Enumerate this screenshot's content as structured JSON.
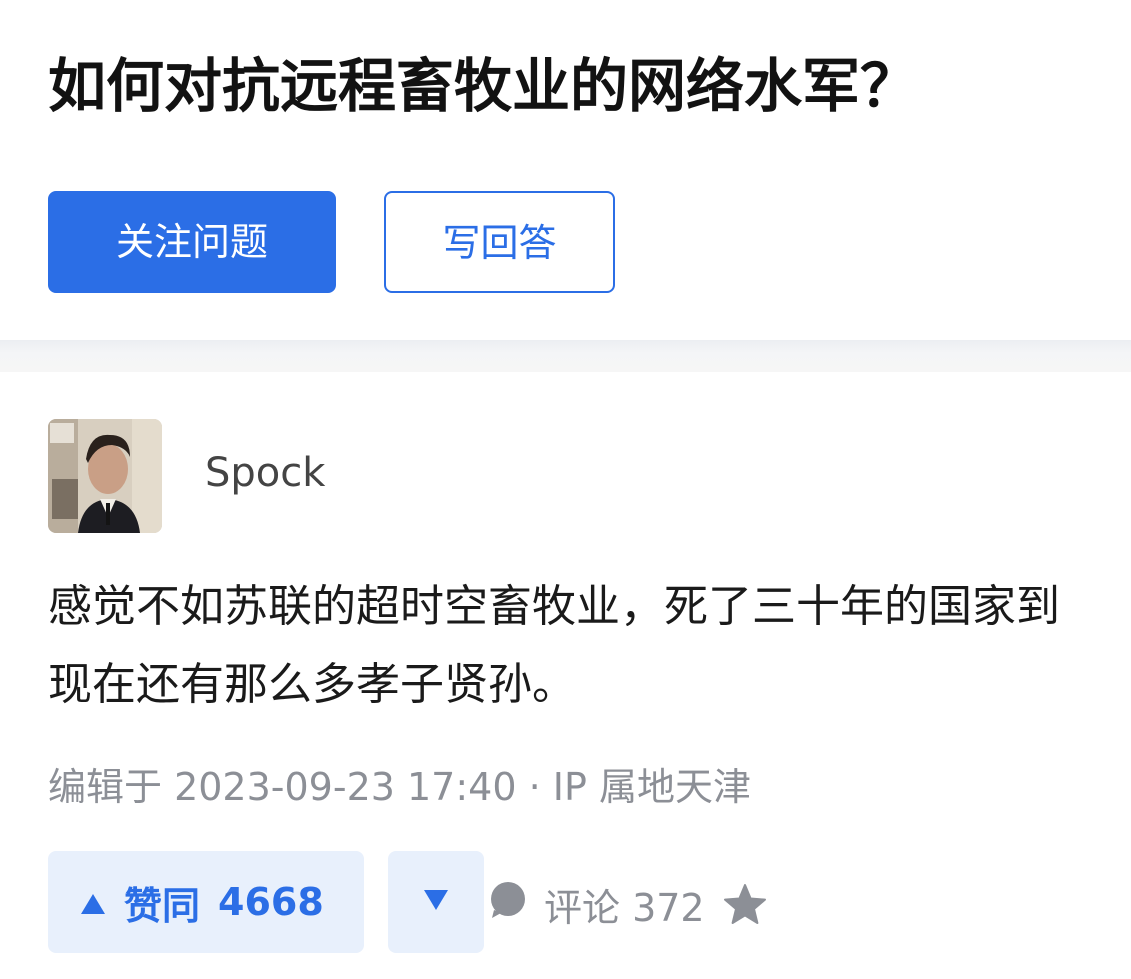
{
  "question": {
    "title": "如何对抗远程畜牧业的网络水军？",
    "follow_label": "关注问题",
    "answer_label": "写回答"
  },
  "answer": {
    "author": "Spock",
    "text": "感觉不如苏联的超时空畜牧业，死了三十年的国家到现在还有那么多孝子贤孙。",
    "meta": "编辑于 2023-09-23 17:40 · IP 属地天津",
    "upvote_label": "赞同",
    "upvote_count": "4668",
    "comment_label": "评论 372"
  },
  "colors": {
    "accent": "#2b6ee6",
    "vote_bg": "#e8f0fc",
    "meta_text": "#8c8f96"
  },
  "icons": {
    "upvote": "triangle-up-icon",
    "downvote": "triangle-down-icon",
    "comment": "comment-bubble-icon",
    "favorite": "star-icon"
  }
}
